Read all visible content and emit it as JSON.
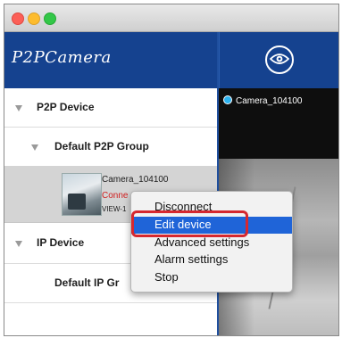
{
  "brand": {
    "title": "P2PCamera"
  },
  "sidebar": {
    "p2p_device_label": "P2P Device",
    "default_p2p_group_label": "Default P2P Group",
    "camera": {
      "name": "Camera_104100",
      "status": "Conne",
      "id": "VIEW-1"
    },
    "ip_device_label": "IP Device",
    "default_ip_group_label": "Default IP Gr"
  },
  "viewer": {
    "camera_title": "Camera_104100",
    "view_icon": "eye-icon"
  },
  "context_menu": {
    "items": [
      "Disconnect",
      "Edit device",
      "Advanced settings",
      "Alarm settings",
      "Stop"
    ],
    "selected": "Edit device"
  },
  "colors": {
    "brand_blue": "#15428f",
    "selection_blue": "#1f64d8",
    "highlight_red": "#d6282f",
    "status_red": "#d02020"
  }
}
